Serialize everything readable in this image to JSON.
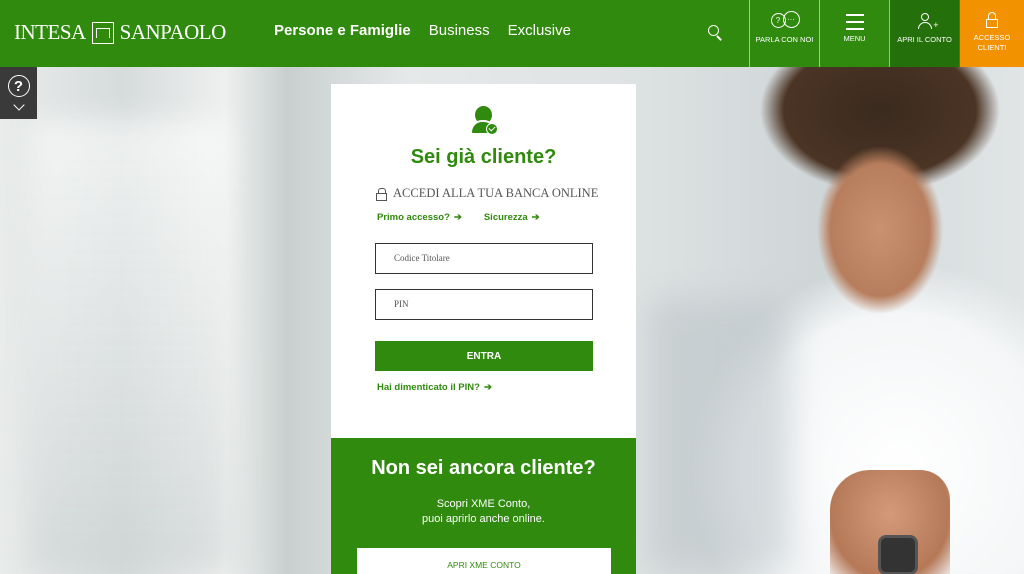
{
  "header": {
    "logo_left": "INTESA",
    "logo_right": "SANPAOLO",
    "nav": [
      "Persone e Famiglie",
      "Business",
      "Exclusive"
    ],
    "buttons": {
      "parla": "PARLA CON NOI",
      "menu": "MENU",
      "apri": "APRI IL CONTO",
      "accesso": "ACCESSO CLIENTI"
    },
    "colors": {
      "brand_green": "#2f8a0d",
      "accent_orange": "#f39200"
    }
  },
  "help": {
    "icon": "question-icon"
  },
  "login": {
    "title": "Sei già cliente?",
    "online_label": "ACCEDI ALLA TUA BANCA ONLINE",
    "link_first": "Primo accesso?",
    "link_security": "Sicurezza",
    "arrow": "➔",
    "user_placeholder": "Codice Titolare",
    "pin_placeholder": "PIN",
    "submit": "ENTRA",
    "forgot": "Hai dimenticato il PIN?"
  },
  "promo": {
    "title": "Non sei ancora cliente?",
    "line1": "Scopri XME Conto,",
    "line2": "puoi aprirlo anche online.",
    "button": "APRI XME CONTO"
  }
}
